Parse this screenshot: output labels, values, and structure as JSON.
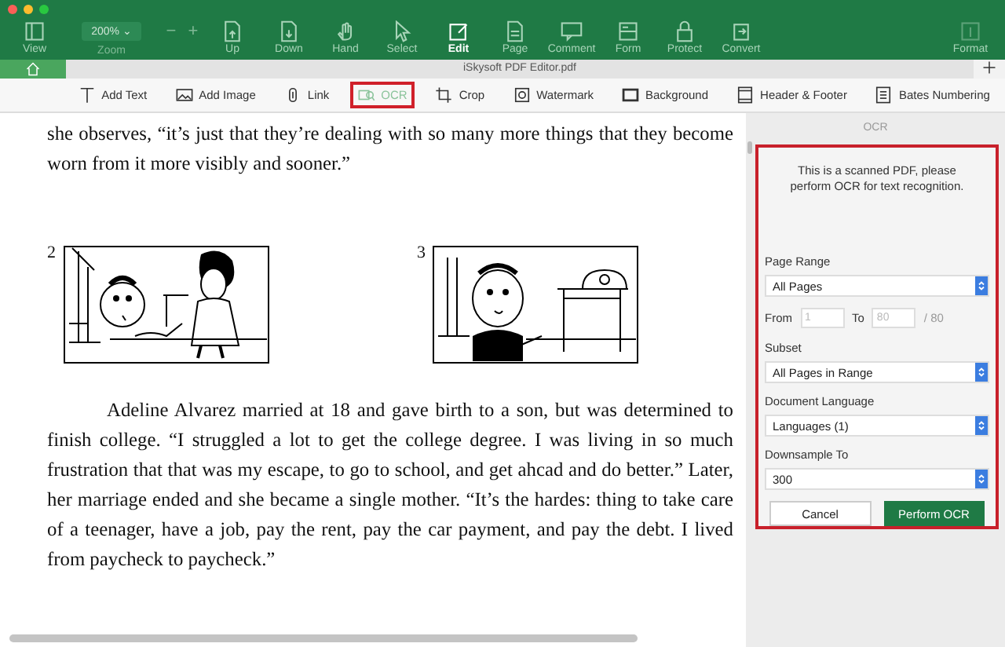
{
  "toolbar": {
    "view": {
      "label": "View",
      "selected": false
    },
    "zoom": {
      "value": "200%",
      "caret": "⌄",
      "label": "Zoom",
      "zoom_out": "−",
      "zoom_in": "+"
    },
    "items": [
      {
        "label": "Up",
        "selected": false,
        "disabled": false
      },
      {
        "label": "Down",
        "selected": false,
        "disabled": false
      },
      {
        "label": "Hand",
        "selected": false,
        "disabled": false
      },
      {
        "label": "Select",
        "selected": false,
        "disabled": false
      },
      {
        "label": "Edit",
        "selected": true,
        "disabled": false
      },
      {
        "label": "Page",
        "selected": false,
        "disabled": false
      },
      {
        "label": "Comment",
        "selected": false,
        "disabled": false
      },
      {
        "label": "Form",
        "selected": false,
        "disabled": false
      },
      {
        "label": "Protect",
        "selected": false,
        "disabled": false
      },
      {
        "label": "Convert",
        "selected": false,
        "disabled": false
      },
      {
        "label": "Format",
        "selected": false,
        "disabled": true
      }
    ]
  },
  "tab": {
    "title": "iSkysoft PDF Editor.pdf"
  },
  "edit_toolbar": [
    {
      "label": "Add Text",
      "selected": false
    },
    {
      "label": "Add Image",
      "selected": false
    },
    {
      "label": "Link",
      "selected": false
    },
    {
      "label": "OCR",
      "selected": true
    },
    {
      "label": "Crop",
      "selected": false
    },
    {
      "label": "Watermark",
      "selected": false
    },
    {
      "label": "Background",
      "selected": false
    },
    {
      "label": "Header & Footer",
      "selected": false
    },
    {
      "label": "Bates Numbering",
      "selected": false
    }
  ],
  "document": {
    "paragraph_1": "she observes, “it’s just that they’re dealing with so many more things that they become worn from it more visibly and sooner.”",
    "figures": [
      {
        "number": "2"
      },
      {
        "number": "3"
      }
    ],
    "paragraph_2": "Adeline Alvarez married at 18 and gave birth to a son, but was determined to finish college. “I struggled a lot to get the college degree. I was living in so much frustration that that was my escape, to go to school, and get ahcad and do better.” Later, her marriage ended and she became a single mother. “It’s the hardes: thing to take care of a teenager, have a job, pay the rent, pay the car payment, and pay the debt. I lived from paycheck to paycheck.”"
  },
  "ocr_panel": {
    "title": "OCR",
    "message": "This is a scanned PDF, please perform OCR for text recognition.",
    "page_range": {
      "label": "Page Range",
      "value": "All Pages"
    },
    "from": {
      "label": "From",
      "placeholder": "1"
    },
    "to": {
      "label": "To",
      "placeholder": "80"
    },
    "total": "/ 80",
    "subset": {
      "label": "Subset",
      "value": "All Pages in Range"
    },
    "language": {
      "label": "Document Language",
      "value": "Languages (1)"
    },
    "downsample": {
      "label": "Downsample To",
      "value": "300"
    },
    "buttons": [
      {
        "label": "Cancel",
        "kind": "secondary"
      },
      {
        "label": "Perform OCR",
        "kind": "primary"
      }
    ]
  }
}
